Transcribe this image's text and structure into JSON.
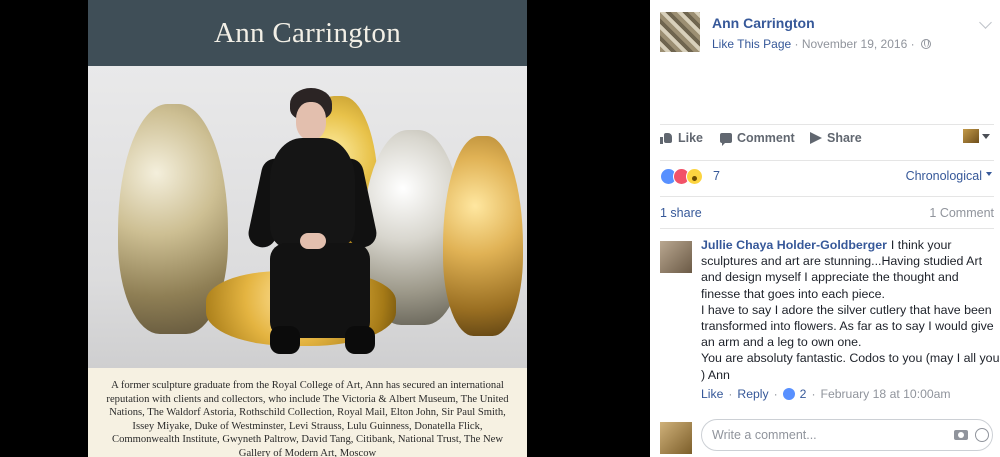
{
  "poster": {
    "title": "Ann Carrington",
    "description": "A former sculpture graduate from the Royal College of Art, Ann has secured an international reputation with clients and collectors, who include The Victoria & Albert Museum, The United Nations, The Waldorf Astoria, Rothschild Collection, Royal Mail, Elton John, Sir Paul Smith, Issey Miyake, Duke of Westminster, Levi Strauss, Lulu Guinness, Donatella Flick, Commonwealth Institute, Gwyneth Paltrow, David Tang, Citibank, National Trust, The New Gallery of Modern Art, Moscow"
  },
  "post": {
    "page_name": "Ann Carrington",
    "like_page": "Like This Page",
    "separator": " · ",
    "date": "November 19, 2016",
    "separator2": " · "
  },
  "actions": {
    "like": "Like",
    "comment": "Comment",
    "share": "Share"
  },
  "reactions": {
    "count": "7",
    "order": "Chronological"
  },
  "counts": {
    "shares": "1 share",
    "comments": "1 Comment"
  },
  "comment": {
    "author": "Jullie Chaya Holder-Goldberger",
    "text": "I think your sculptures and art are stunning...Having studied Art and design myself I appreciate the thought and finesse that goes into each piece.\nI have to say I adore the silver cutlery that have been transformed into flowers. As far as to say I would give an arm and a leg to own one.\nYou are absoluty fantastic. Codos to you (may I all you ) Ann",
    "like": "Like",
    "dot1": "·",
    "reply": "Reply",
    "dot2": "·",
    "likes": "2",
    "dot3": "·",
    "timestamp": "February 18 at 10:00am"
  },
  "composer": {
    "placeholder": "Write a comment..."
  }
}
